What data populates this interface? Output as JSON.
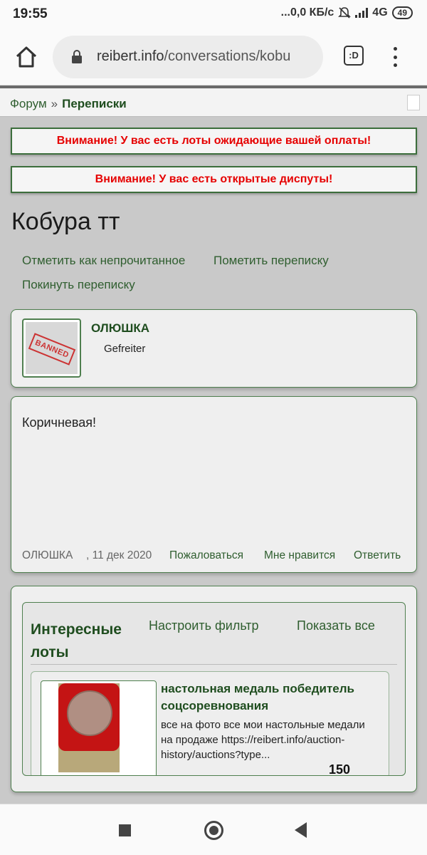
{
  "status_bar": {
    "time": "19:55",
    "network_speed": "...0,0 КБ/с",
    "network_type": "4G",
    "battery": "49"
  },
  "browser": {
    "url_host": "reibert.info",
    "url_path": "/conversations/kobu",
    "tabs_label": ":D",
    "icons": [
      "home-icon",
      "lock-icon",
      "tabs-icon",
      "menu-icon"
    ]
  },
  "breadcrumb": {
    "forum": "Форум",
    "separator": "»",
    "current": "Переписки"
  },
  "alerts": [
    "Внимание! У вас есть лоты ожидающие вашей оплаты!",
    "Внимание! У вас есть открытые диспуты!"
  ],
  "conversation": {
    "title": "Кобура тт",
    "actions": {
      "mark_unread": "Отметить как непрочитанное",
      "mark_conversation": "Пометить переписку",
      "leave": "Покинуть переписку"
    }
  },
  "user": {
    "name": "ОЛЮШКА",
    "rank": "Gefreiter",
    "avatar_stamp": "BANNED"
  },
  "message": {
    "text": "Коричневая!",
    "author": "ОЛЮШКА",
    "date": ", 11 дек 2020",
    "report": "Пожаловаться",
    "like": "Мне нравится",
    "reply": "Ответить"
  },
  "lots": {
    "title": "Интересные лоты",
    "filter_link": "Настроить фильтр",
    "show_all_link": "Показать все",
    "items": [
      {
        "title": "настольная медаль победитель соцсоревнования",
        "description": "все на фото все мои настольные медали на продаже https://reibert.info/auction-history/auctions?type...",
        "price": "150"
      }
    ]
  },
  "colors": {
    "link_green": "#2f5e2f",
    "alert_red": "#e60000",
    "page_bg": "#c9c9c9"
  }
}
